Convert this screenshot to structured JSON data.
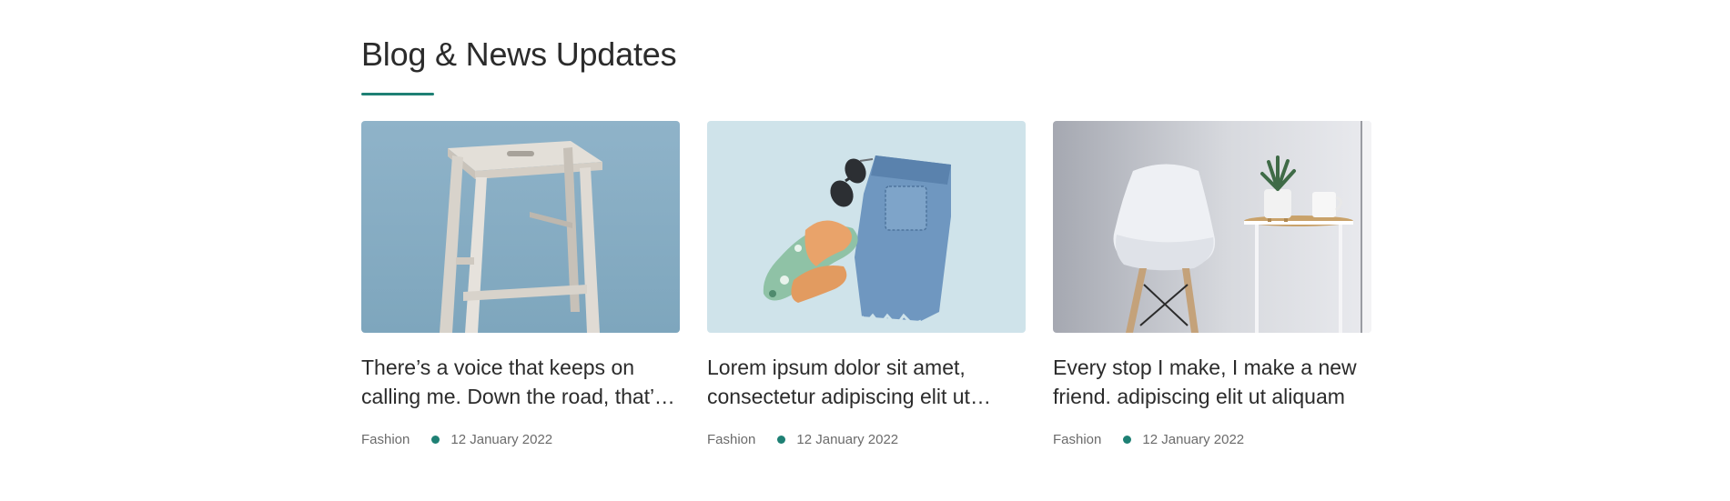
{
  "section": {
    "title": "Blog & News Updates"
  },
  "posts": [
    {
      "image": "stool-image",
      "title": "There’s a voice that keeps on calling me. Down the road, that’s where I’ll always be.",
      "category": "Fashion",
      "date": "12 January 2022"
    },
    {
      "image": "denim-shorts-image",
      "title": "Lorem ipsum dolor sit amet, consectetur adipiscing elit ut aliquam purus sit amet.",
      "category": "Fashion",
      "date": "12 January 2022"
    },
    {
      "image": "white-chair-image",
      "title": "Every stop I make, I make a new friend. adipiscing elit ut aliquam",
      "category": "Fashion",
      "date": "12 January 2022"
    }
  ],
  "colors": {
    "accent": "#1e8074",
    "text": "#2b2b2b",
    "meta": "#6b6b6b"
  }
}
